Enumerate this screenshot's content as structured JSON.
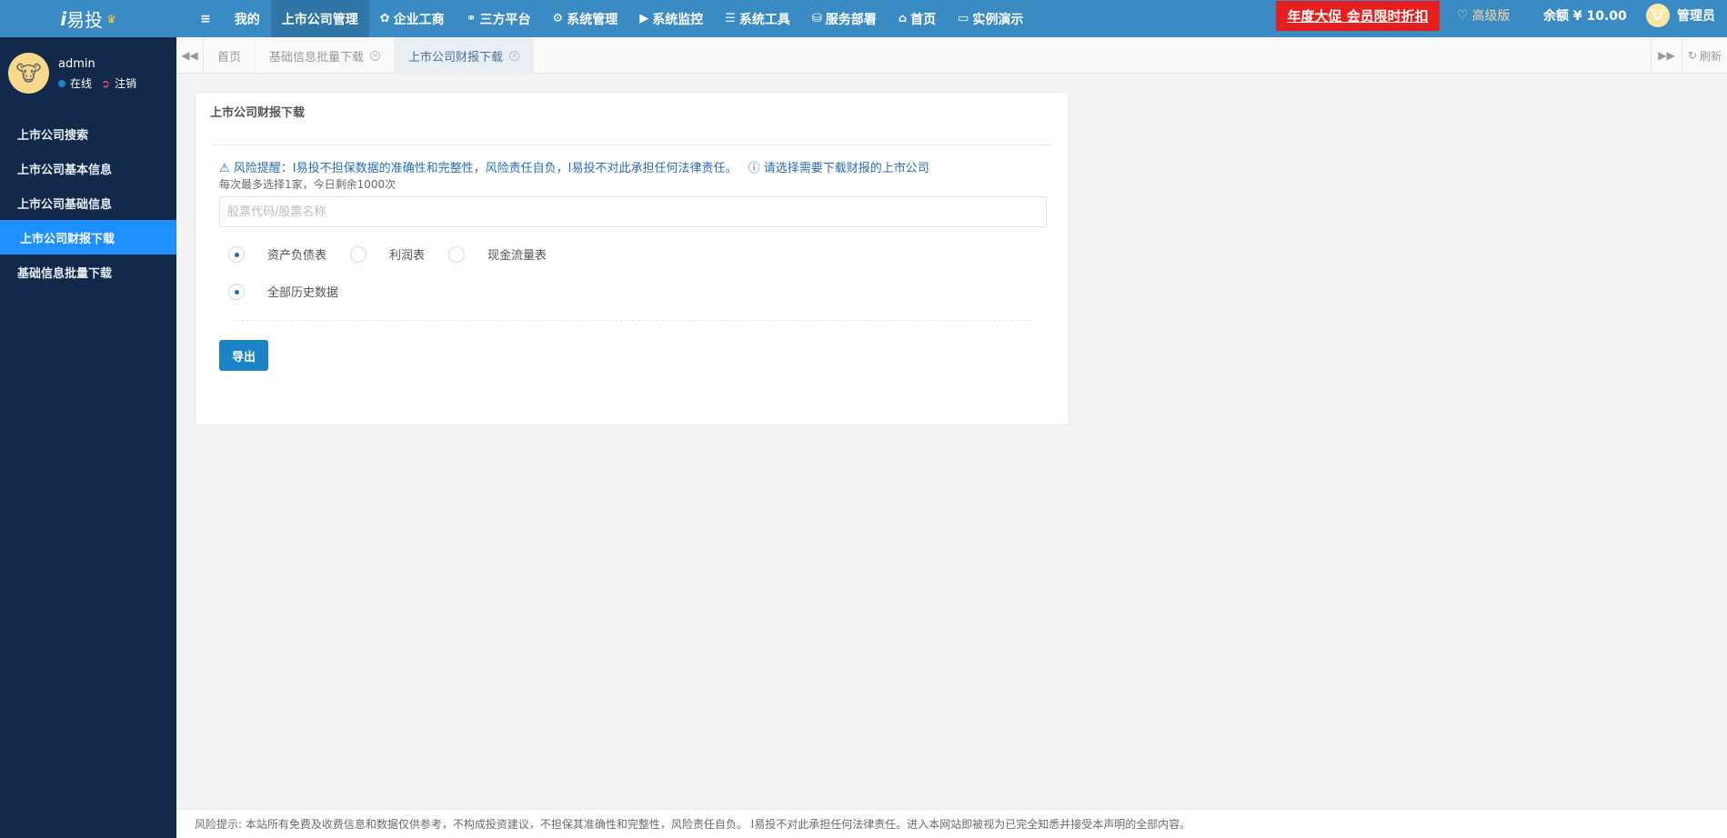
{
  "app": {
    "logo_i": "i",
    "logo_text": "易投",
    "logo_crown": "♛"
  },
  "nav": {
    "menu_toggle": "≡",
    "items": [
      {
        "label": "我的",
        "icon": ""
      },
      {
        "label": "上市公司管理",
        "icon": ""
      },
      {
        "label": "企业工商",
        "icon": "✿"
      },
      {
        "label": "三方平台",
        "icon": "⚭"
      },
      {
        "label": "系统管理",
        "icon": "⚙"
      },
      {
        "label": "系统监控",
        "icon": "▶"
      },
      {
        "label": "系统工具",
        "icon": "☰"
      },
      {
        "label": "服务部署",
        "icon": "⛁"
      },
      {
        "label": "首页",
        "icon": "⌂"
      },
      {
        "label": "实例演示",
        "icon": "▭"
      }
    ],
    "promo": "年度大促  会员限时折扣",
    "level_icon": "♡",
    "level": "高级版",
    "balance": "余额 ¥ 10.00",
    "user": "管理员"
  },
  "profile": {
    "name": "admin",
    "status": "在线",
    "logout": "注销"
  },
  "sidebar": {
    "items": [
      {
        "label": "上市公司搜索"
      },
      {
        "label": "上市公司基本信息"
      },
      {
        "label": "上市公司基础信息"
      },
      {
        "label": "上市公司财报下载"
      },
      {
        "label": "基础信息批量下载"
      }
    ]
  },
  "tabs": {
    "items": [
      {
        "label": "首页"
      },
      {
        "label": "基础信息批量下载"
      },
      {
        "label": "上市公司财报下载"
      }
    ],
    "refresh": "刷新"
  },
  "panel": {
    "title": "上市公司财报下载",
    "warning": "风险提醒：I易投不担保数据的准确性和完整性，风险责任自负，I易投不对此承担任何法律责任。",
    "hint": "请选择需要下载财报的上市公司",
    "note": "每次最多选择1家，今日剩余1000次",
    "search_placeholder": "股票代码/股票名称",
    "report_types": [
      "资产负债表",
      "利润表",
      "现金流量表"
    ],
    "range_option": "全部历史数据",
    "export_button": "导出"
  },
  "footer": {
    "text": "风险提示: 本站所有免费及收费信息和数据仅供参考，不构成投资建议，不担保其准确性和完整性，风险责任自负。 I易投不对此承担任何法律责任。进入本网站即被视为已完全知悉并接受本声明的全部内容。"
  }
}
